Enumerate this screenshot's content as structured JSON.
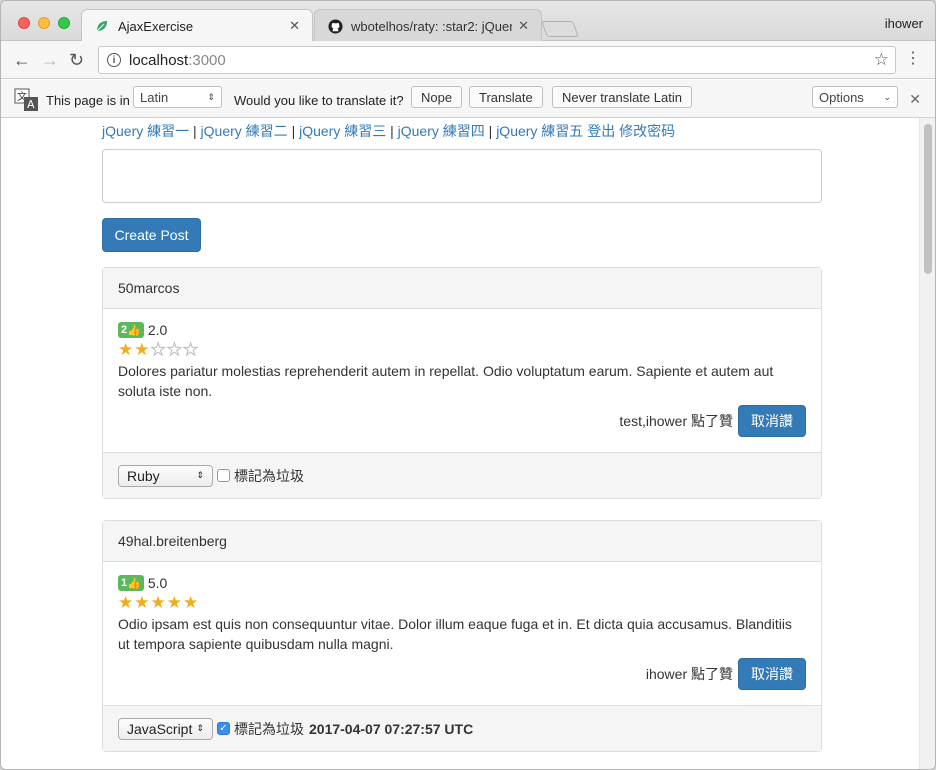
{
  "browser": {
    "tabs": [
      {
        "title": "AjaxExercise",
        "favicon": "leaf-icon",
        "active": true
      },
      {
        "title": "wbotelhos/raty: :star2: jQuery",
        "favicon": "github-icon",
        "active": false
      }
    ],
    "profile": "ihower",
    "url_host": "localhost",
    "url_port": ":3000"
  },
  "translate_bar": {
    "prefix": "This page is in",
    "language": "Latin",
    "question": "Would you like to translate it?",
    "nope": "Nope",
    "translate": "Translate",
    "never": "Never translate Latin",
    "options": "Options"
  },
  "nav": {
    "links": [
      "jQuery 練習一",
      "jQuery 練習二",
      "jQuery 練習三",
      "jQuery 練習四",
      "jQuery 練習五"
    ],
    "separator": "|",
    "logout": "登出",
    "change_password": "修改密码"
  },
  "form": {
    "create_label": "Create Post"
  },
  "posts": [
    {
      "author": "50marcos",
      "likes_badge": "2",
      "rating_text": "2.0",
      "rating": 2,
      "rating_max": 5,
      "body": "Dolores pariatur molestias reprehenderit autem in repellat. Odio voluptatum earum. Sapiente et autem aut soluta iste non.",
      "liked_by": "test,ihower 點了贊",
      "unlike_label": "取消讚",
      "category": "Ruby",
      "flag_label": "標記為垃圾",
      "flagged": false,
      "flagged_at": ""
    },
    {
      "author": "49hal.breitenberg",
      "likes_badge": "1",
      "rating_text": "5.0",
      "rating": 5,
      "rating_max": 5,
      "body": "Odio ipsam est quis non consequuntur vitae. Dolor illum eaque fuga et in. Et dicta quia accusamus. Blanditiis ut tempora sapiente quibusdam nulla magni.",
      "liked_by": "ihower 點了贊",
      "unlike_label": "取消讚",
      "category": "JavaScript",
      "flag_label": "標記為垃圾",
      "flagged": true,
      "flagged_at": "2017-04-07 07:27:57 UTC"
    }
  ],
  "colors": {
    "link": "#337ab7",
    "primary_button": "#337ab7",
    "badge": "#5cb85c",
    "star": "#f0ad1c"
  }
}
